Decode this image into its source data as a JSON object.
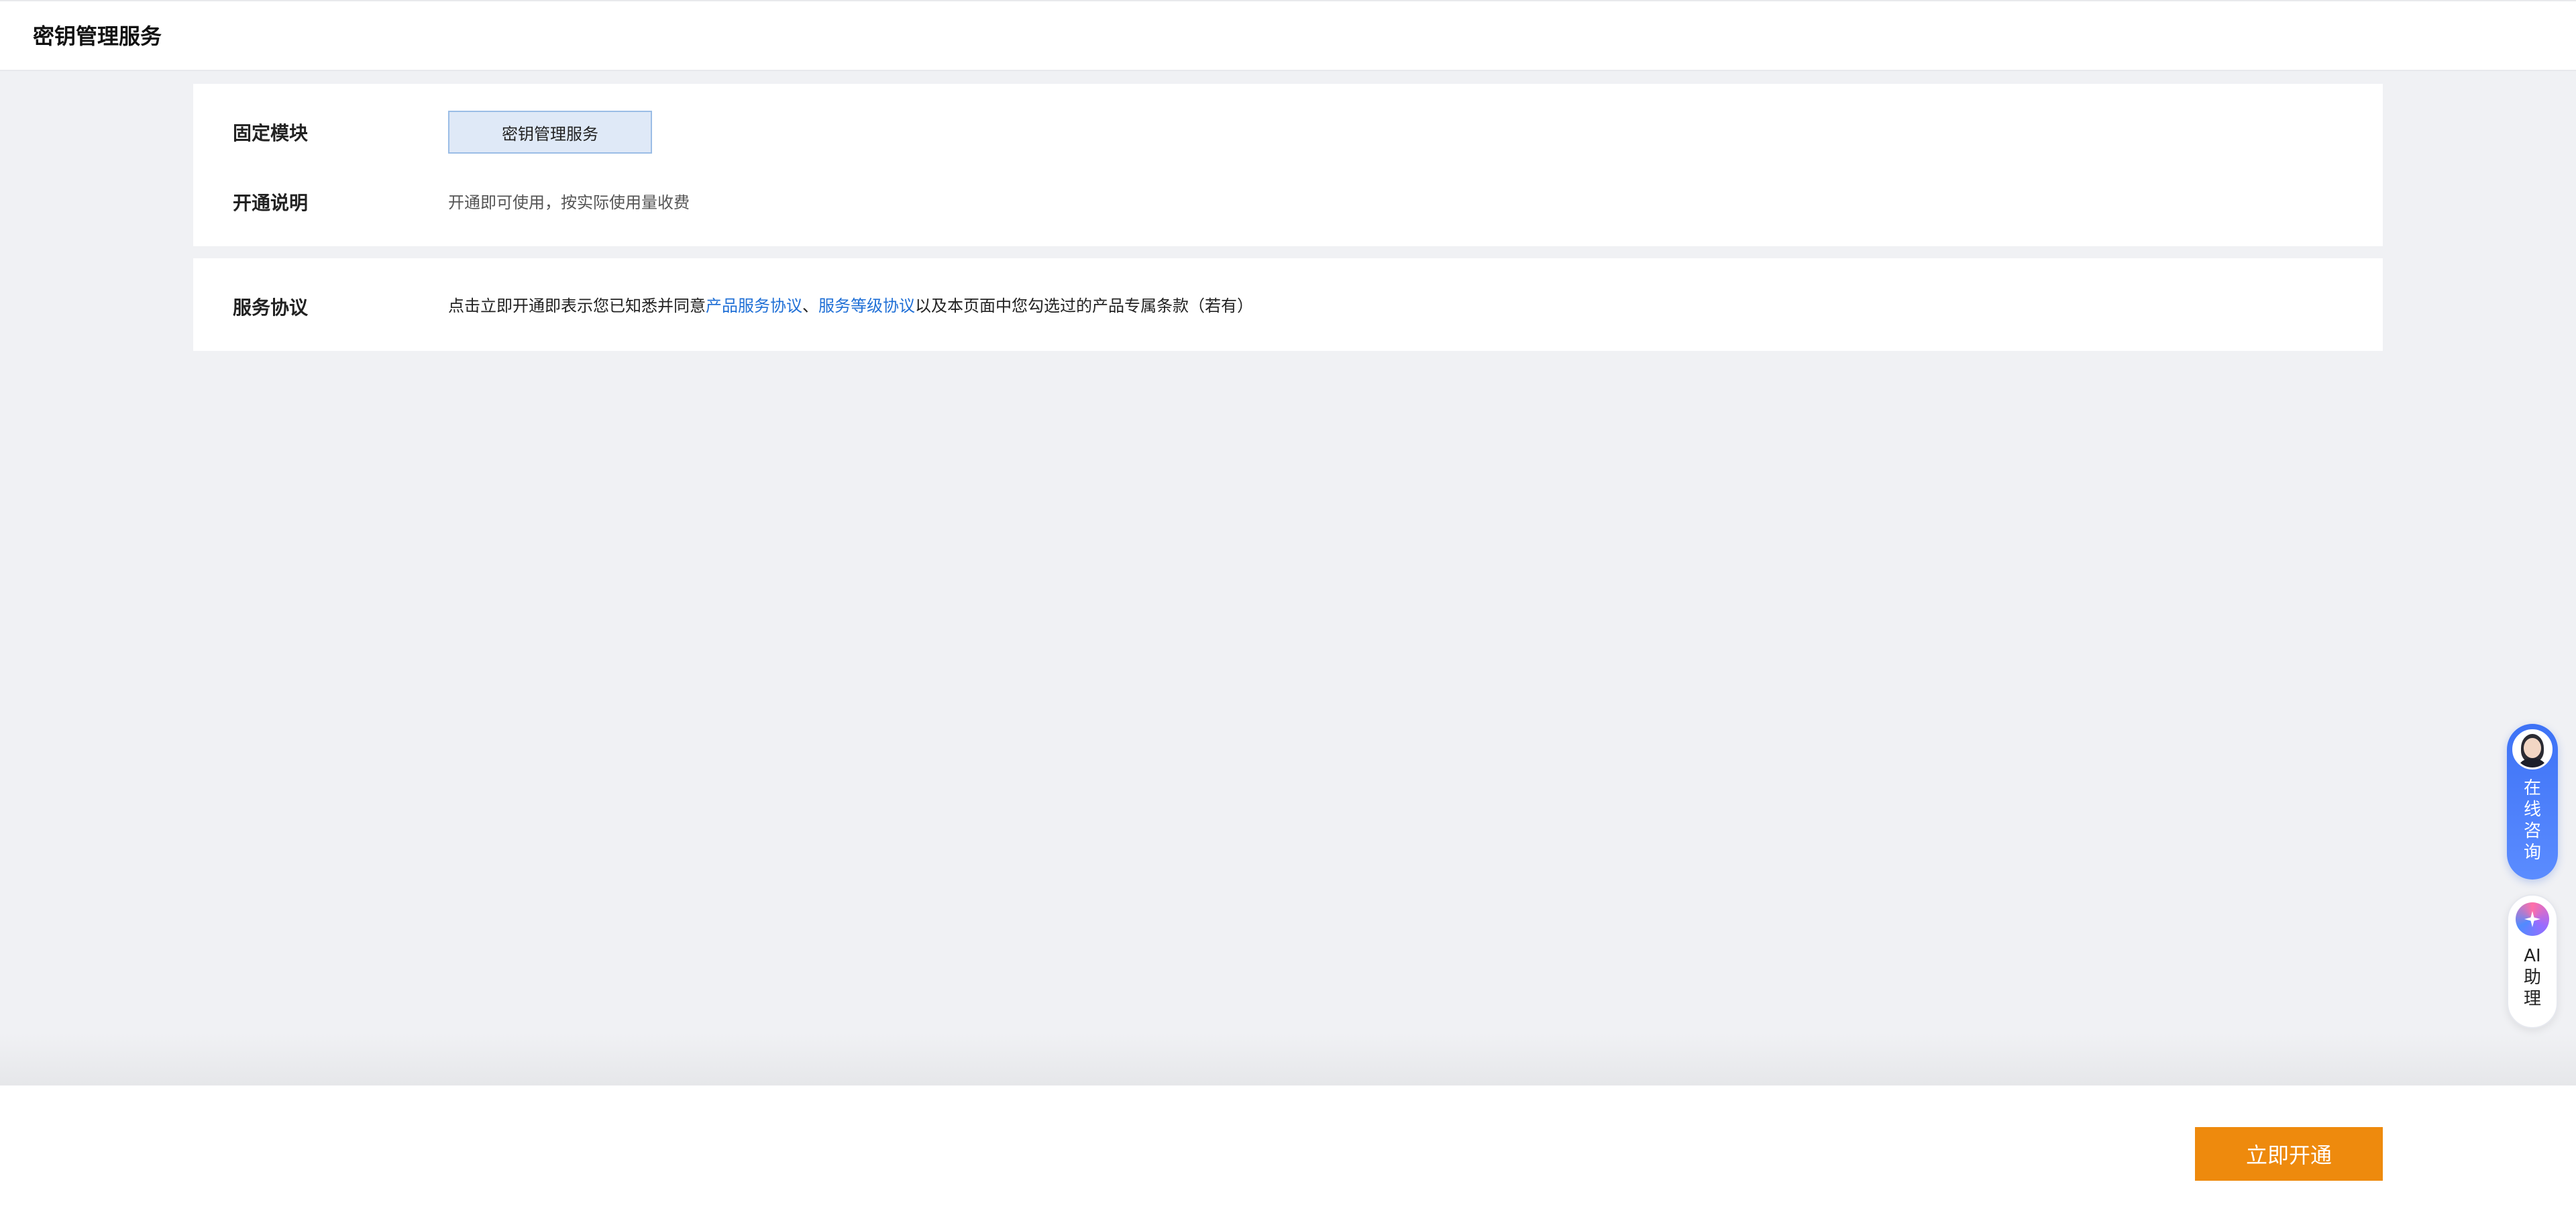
{
  "header": {
    "title": "密钥管理服务"
  },
  "config": {
    "module_label": "固定模块",
    "module_value": "密钥管理服务",
    "desc_label": "开通说明",
    "desc_text": "开通即可使用，按实际使用量收费"
  },
  "agreement": {
    "label": "服务协议",
    "prefix": "点击立即开通即表示您已知悉并同意",
    "link1": "产品服务协议",
    "sep": "、",
    "link2": "服务等级协议",
    "suffix": "以及本页面中您勾选过的产品专属条款（若有）"
  },
  "footer": {
    "submit_label": "立即开通"
  },
  "floating": {
    "consult_label": "在线咨询",
    "ai_label": "AI助理"
  },
  "colors": {
    "accent_orange": "#ee8a0d",
    "link_blue": "#1f6fd6",
    "consult_blue": "#3d72f6",
    "chip_bg": "#dfe9f7"
  },
  "icons": {
    "consult": "agent-avatar-icon",
    "ai": "ai-sparkle-icon"
  }
}
